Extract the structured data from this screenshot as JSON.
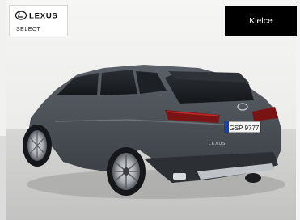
{
  "brand": {
    "name": "LEXUS",
    "logo_icon": "lexus-l-emblem-icon",
    "subtitle": "SELECT"
  },
  "location": {
    "label": "Kielce"
  },
  "photo": {
    "subject": "car-rear-three-quarter-view",
    "vehicle_color": "#4b5056",
    "license_plate": "GSP 9777",
    "badge": "LEXUS"
  },
  "colors": {
    "location_button_bg": "#000000",
    "location_button_text": "#ffffff",
    "brand_card_bg": "#ffffff"
  }
}
